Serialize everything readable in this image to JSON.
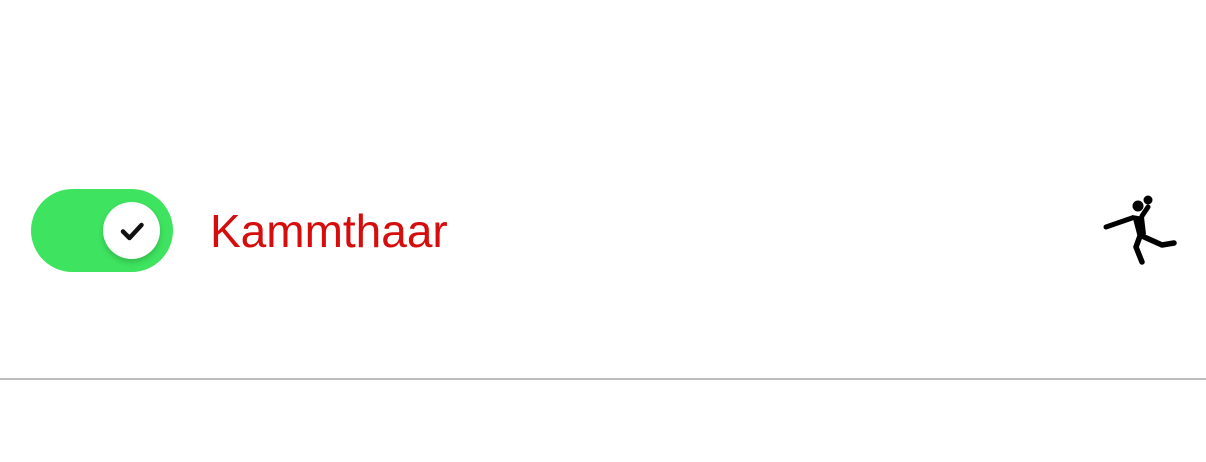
{
  "row": {
    "label": "Kammthaar",
    "label_color": "#d60d0d",
    "toggle": {
      "state": "on",
      "on_color": "#3ee35f",
      "knob_icon": "checkmark-icon"
    },
    "trailing_icon": "handball-player-icon"
  },
  "divider_color": "#bdbdbd"
}
